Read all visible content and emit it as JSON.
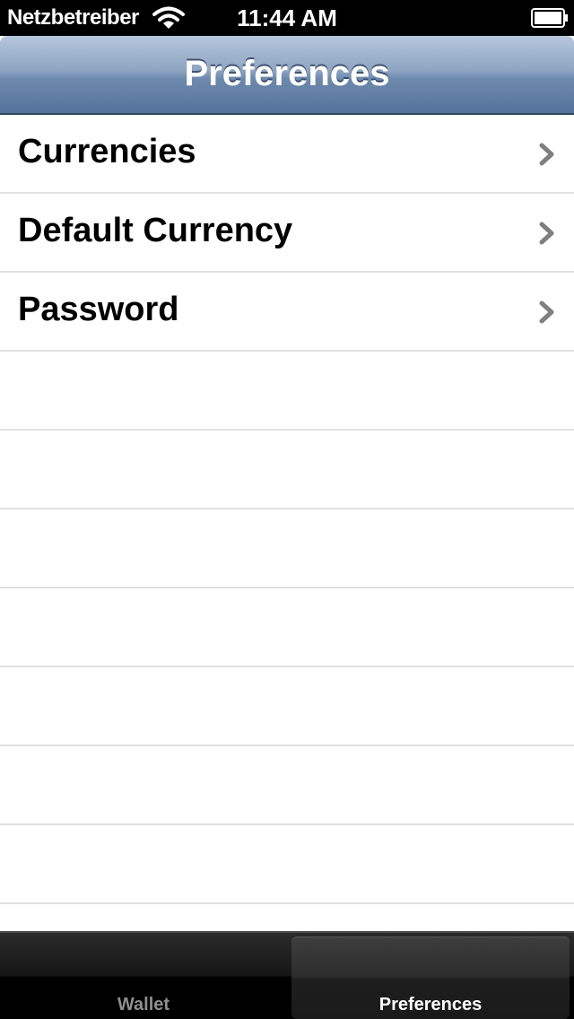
{
  "status_bar": {
    "carrier": "Netzbetreiber",
    "time": "11:44 AM",
    "wifi_icon": "wifi-icon",
    "battery_icon": "battery-icon"
  },
  "nav_bar": {
    "title": "Preferences",
    "accent_color": "#6d89ad"
  },
  "table": {
    "rows": [
      {
        "label": "Currencies",
        "icon": "chevron-right-icon"
      },
      {
        "label": "Default Currency",
        "icon": "chevron-right-icon"
      },
      {
        "label": "Password",
        "icon": "chevron-right-icon"
      }
    ],
    "separator_color": "#e0e0e0"
  },
  "tab_bar": {
    "tabs": [
      {
        "label": "Wallet",
        "selected": false
      },
      {
        "label": "Preferences",
        "selected": true
      }
    ]
  }
}
